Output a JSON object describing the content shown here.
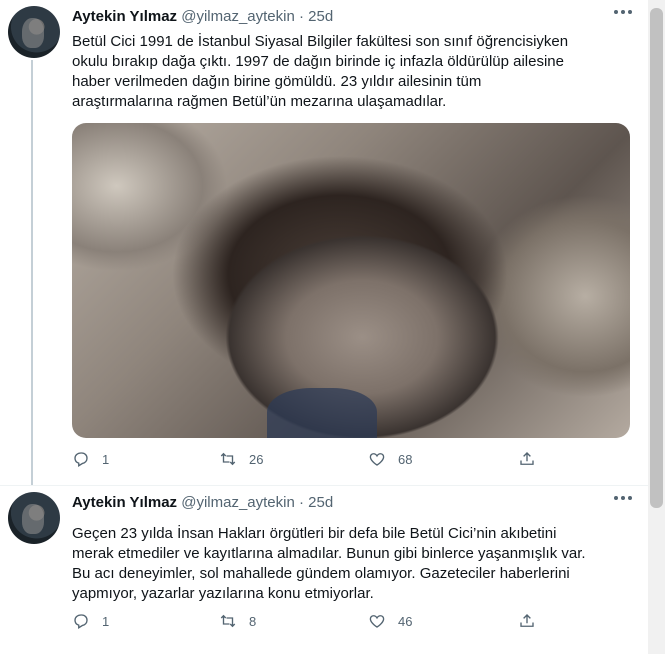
{
  "tweets": [
    {
      "name": "Aytekin Yılmaz",
      "handle": "@yilmaz_aytekin",
      "dot": "·",
      "time": "25d",
      "lines": [
        "Betül Cici 1991 de İstanbul Siyasal Bilgiler fakültesi son sınıf öğrencisiyken",
        "okulu bırakıp dağa çıktı. 1997 de dağın birinde iç infazla öldürülüp ailesine",
        "haber verilmeden dağın birine gömüldü. 23 yıldır ailesinin tüm",
        "araştırmalarına rağmen Betül’ün mezarına ulaşamadılar."
      ],
      "replies": "1",
      "retweets": "26",
      "likes": "68",
      "has_photo": true
    },
    {
      "name": "Aytekin Yılmaz",
      "handle": "@yilmaz_aytekin",
      "dot": "·",
      "time": "25d",
      "lines": [
        "Geçen 23 yılda İnsan Hakları örgütleri bir defa bile Betül Cici’nin akıbetini",
        "merak etmediler ve kayıtlarına almadılar. Bunun gibi binlerce yaşanmışlık var.",
        "Bu acı deneyimler, sol mahallede gündem olamıyor. Gazeteciler haberlerini",
        "yapmıyor, yazarlar yazılarına konu etmiyorlar."
      ],
      "replies": "1",
      "retweets": "8",
      "likes": "46",
      "has_photo": false
    }
  ],
  "colors": {
    "text": "#0f1419",
    "secondary": "#536471",
    "thread_line": "#c4cfd6",
    "divider": "#eff3f4"
  },
  "icons": [
    "reply-icon",
    "retweet-icon",
    "like-icon",
    "share-icon",
    "more-icon"
  ]
}
